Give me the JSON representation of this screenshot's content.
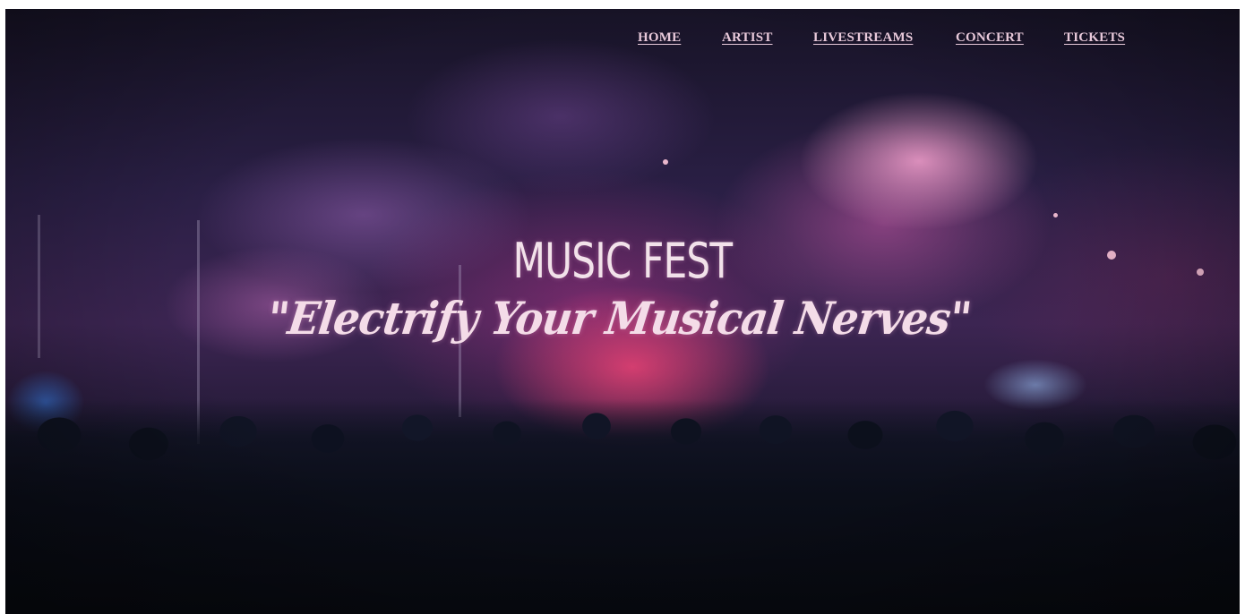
{
  "nav": {
    "items": [
      {
        "label": "HOME"
      },
      {
        "label": "ARTIST"
      },
      {
        "label": "LIVESTREAMS"
      },
      {
        "label": "CONCERT"
      },
      {
        "label": "TICKETS"
      }
    ]
  },
  "hero": {
    "title": "MUSIC FEST",
    "tagline": "\"Electrify Your Musical Nerves\""
  },
  "colors": {
    "nav_text": "#e8c9da",
    "hero_text": "#f2e2ea"
  }
}
